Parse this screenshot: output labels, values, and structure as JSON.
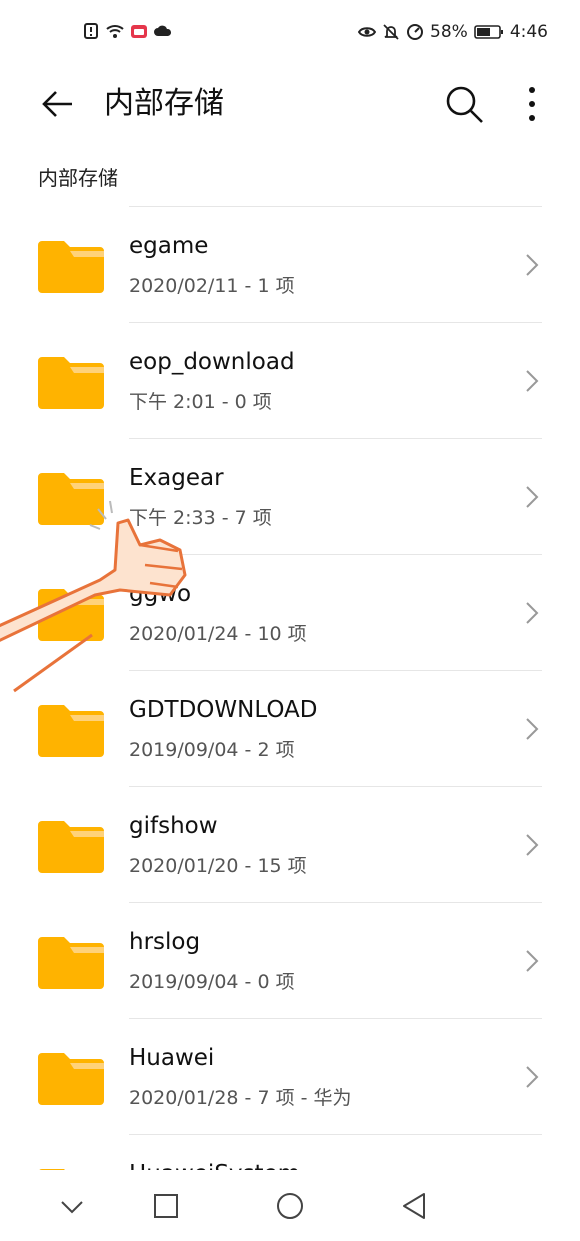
{
  "status_bar": {
    "battery_percent": "58%",
    "time": "4:46",
    "left_icons": [
      "sim-alert-icon",
      "wifi-icon",
      "tv-app-icon",
      "cloud-icon"
    ],
    "right_icons": [
      "eye-comfort-icon",
      "mute-bell-icon",
      "data-saver-icon",
      "battery-icon"
    ]
  },
  "app_bar": {
    "title": "内部存储"
  },
  "breadcrumb": {
    "label": "内部存储"
  },
  "files": [
    {
      "name": "egame",
      "meta": "2020/02/11 - 1 项"
    },
    {
      "name": "eop_download",
      "meta": "下午 2:01  - 0 项"
    },
    {
      "name": "Exagear",
      "meta": "下午 2:33  - 7 项"
    },
    {
      "name": "ggwo",
      "meta": "2020/01/24 - 10 项"
    },
    {
      "name": "GDTDOWNLOAD",
      "meta": "2019/09/04 - 2 项"
    },
    {
      "name": "gifshow",
      "meta": "2020/01/20 - 15 项"
    },
    {
      "name": "hrslog",
      "meta": "2019/09/04 - 0 项"
    },
    {
      "name": "Huawei",
      "meta": "2020/01/28 - 7 项 - 华为"
    },
    {
      "name": "HuaweiSystem",
      "meta": ""
    }
  ],
  "colors": {
    "folder": "#FFB300",
    "folder_tab": "#FFD27A",
    "accent": "#111111"
  }
}
